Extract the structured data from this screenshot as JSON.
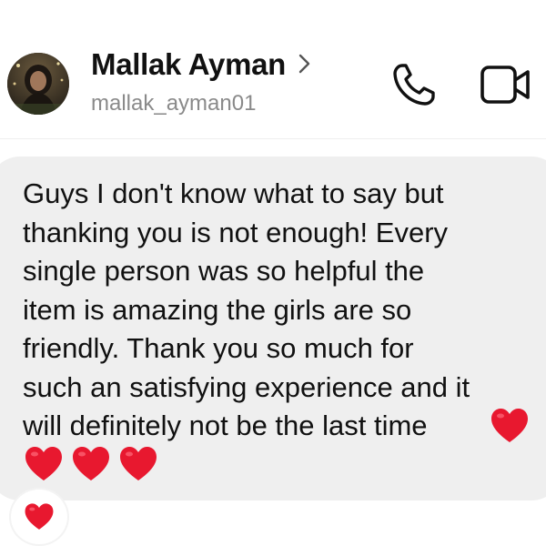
{
  "header": {
    "contact_name": "Mallak Ayman",
    "username": "mallak_ayman01",
    "icons": {
      "avatar": "profile-photo",
      "chevron": "chevron-right-icon",
      "call": "phone-icon",
      "video": "video-camera-icon"
    }
  },
  "message": {
    "text": "Guys I don't know what to say but\nthanking you is not enough! Every\nsingle person was so helpful the\nitem is amazing the girls are so\nfriendly. Thank you so much for\nsuch an satisfying experience and it\nwill definitely not be the last time",
    "trailing_emoji": "❤️",
    "hearts_line": [
      "❤️",
      "❤️",
      "❤️"
    ],
    "reaction": "❤️"
  },
  "colors": {
    "bubble_bg": "#efefef",
    "text": "#111111",
    "secondary_text": "#8a8a8a",
    "heart": "#e8182f"
  }
}
